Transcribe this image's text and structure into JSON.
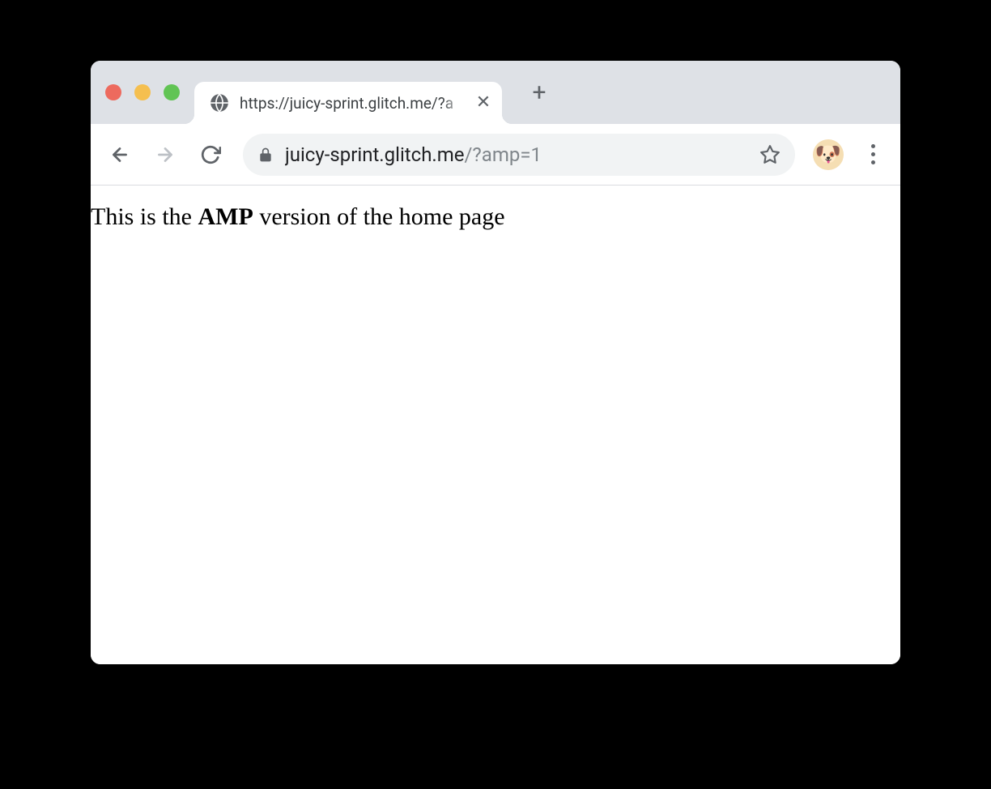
{
  "tab": {
    "title": "https://juicy-sprint.glitch.me/?a"
  },
  "address": {
    "domain": "juicy-sprint.glitch.me",
    "path": "/?amp=1"
  },
  "page": {
    "text_prefix": "This is the ",
    "text_bold": "AMP",
    "text_suffix": " version of the home page"
  },
  "avatar": {
    "emoji": "🐶"
  }
}
